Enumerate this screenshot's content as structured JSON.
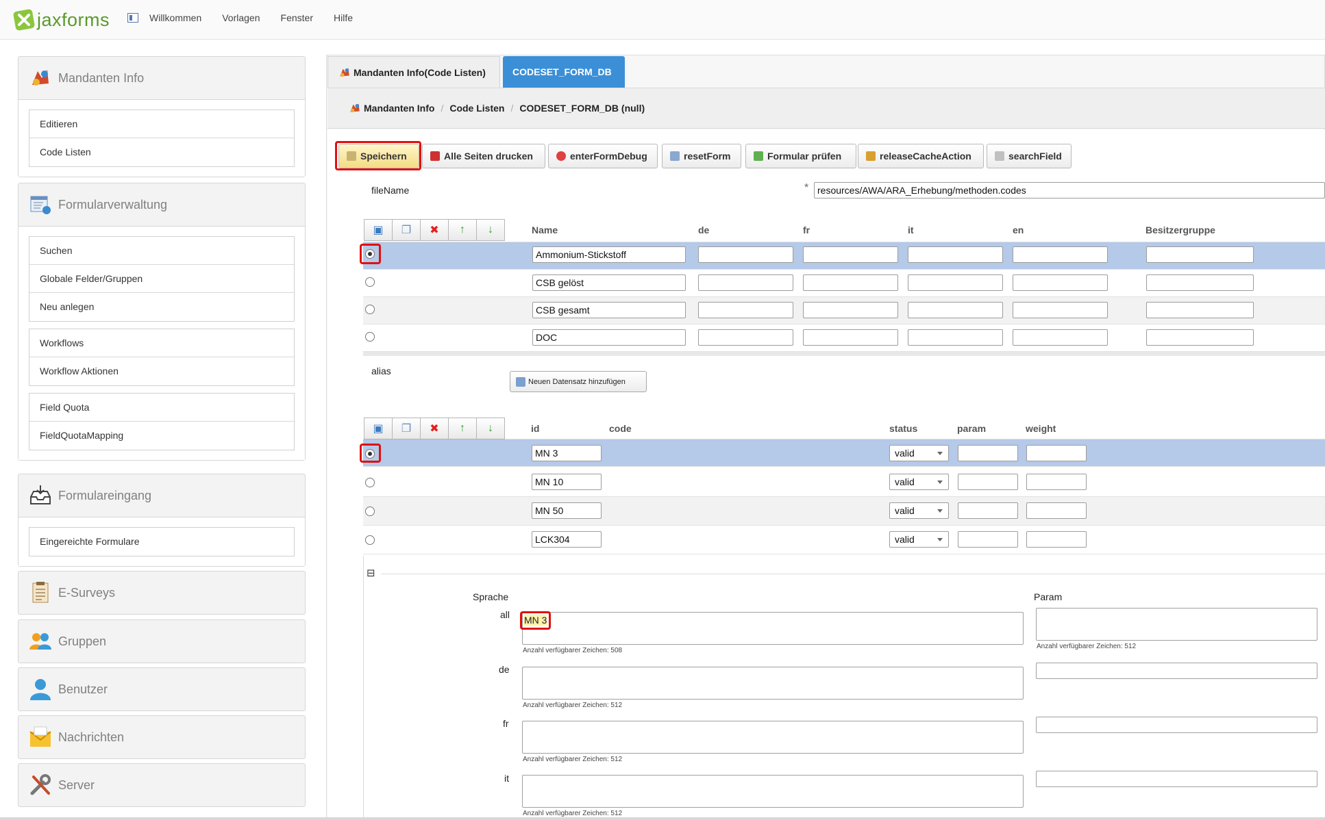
{
  "app": {
    "logo_text": "jaxforms"
  },
  "topmenu": {
    "items": [
      "Willkommen",
      "Vorlagen",
      "Fenster",
      "Hilfe"
    ]
  },
  "sidebar": {
    "mandanten": {
      "title": "Mandanten Info",
      "items": [
        "Editieren",
        "Code Listen"
      ]
    },
    "formularverwaltung": {
      "title": "Formularverwaltung",
      "groups": [
        [
          "Suchen",
          "Globale Felder/Gruppen",
          "Neu anlegen"
        ],
        [
          "Workflows",
          "Workflow Aktionen"
        ],
        [
          "Field Quota",
          "FieldQuotaMapping"
        ]
      ]
    },
    "formulareingang": {
      "title": "Formulareingang",
      "items": [
        "Eingereichte Formulare"
      ]
    },
    "esurveys": {
      "title": "E-Surveys"
    },
    "gruppen": {
      "title": "Gruppen"
    },
    "benutzer": {
      "title": "Benutzer"
    },
    "nachrichten": {
      "title": "Nachrichten"
    },
    "server": {
      "title": "Server"
    }
  },
  "tabs": {
    "tab1": "Mandanten Info(Code Listen)",
    "tab2": "CODESET_FORM_DB"
  },
  "breadcrumb": {
    "part1": "Mandanten Info",
    "part2": "Code Listen",
    "part3": "CODESET_FORM_DB (null)"
  },
  "toolbar": {
    "speichern": "Speichern",
    "drucken": "Alle Seiten drucken",
    "debug": "enterFormDebug",
    "reset": "resetForm",
    "pruefen": "Formular prüfen",
    "cache": "releaseCacheAction",
    "search": "searchField"
  },
  "filename": {
    "label": "fileName",
    "required_mark": "*",
    "value": "resources/AWA/ARA_Erhebung/methoden.codes"
  },
  "table1": {
    "headers": {
      "name": "Name",
      "de": "de",
      "fr": "fr",
      "it": "it",
      "en": "en",
      "owner": "Besitzergruppe"
    },
    "rows": [
      {
        "name": "Ammonium-Stickstoff"
      },
      {
        "name": "CSB gelöst"
      },
      {
        "name": "CSB gesamt"
      },
      {
        "name": "DOC"
      }
    ]
  },
  "alias": {
    "label": "alias",
    "add_button": "Neuen Datensatz hinzufügen"
  },
  "table2": {
    "headers": {
      "id": "id",
      "code": "code",
      "status": "status",
      "param": "param",
      "weight": "weight"
    },
    "rows": [
      {
        "id": "MN 3",
        "status": "valid"
      },
      {
        "id": "MN 10",
        "status": "valid"
      },
      {
        "id": "MN 50",
        "status": "valid"
      },
      {
        "id": "LCK304",
        "status": "valid"
      }
    ]
  },
  "detail": {
    "collapse_icon": "⊟",
    "sprache_label": "Sprache",
    "param_label": "Param",
    "all_label": "all",
    "all_value": "MN 3",
    "all_hint": "Anzahl verfügbarer Zeichen: 508",
    "param_hint": "Anzahl verfügbarer Zeichen: 512",
    "de_label": "de",
    "de_hint": "Anzahl verfügbarer Zeichen: 512",
    "fr_label": "fr",
    "fr_hint": "Anzahl verfügbarer Zeichen: 512",
    "it_label": "it",
    "it_hint": "Anzahl verfügbarer Zeichen: 512"
  },
  "colors": {
    "accent": "#3b8fd6",
    "selected_row": "#b5c9e8",
    "highlight": "#e01010",
    "logo_green": "#5a9a2a"
  }
}
